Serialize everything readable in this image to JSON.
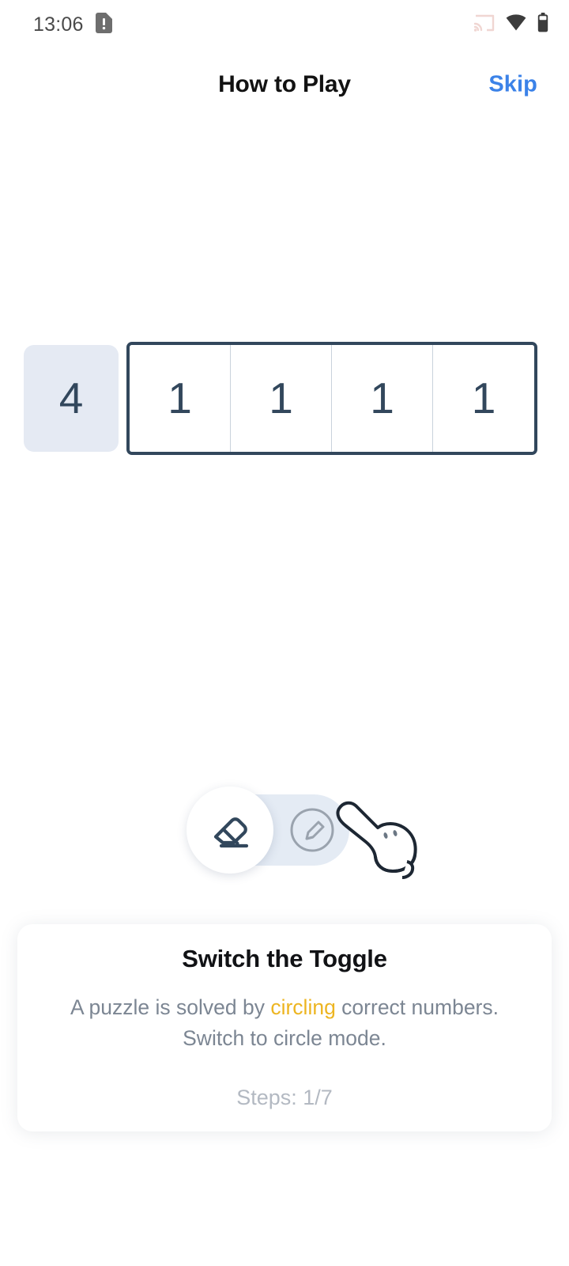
{
  "status_bar": {
    "time": "13:06",
    "sim_icon": "sim-card-alert-icon",
    "cast_icon": "cast-icon",
    "wifi_icon": "wifi-icon",
    "battery_icon": "battery-icon"
  },
  "header": {
    "title": "How to Play",
    "skip_label": "Skip"
  },
  "board": {
    "clue": "4",
    "cells": [
      "1",
      "1",
      "1",
      "1"
    ]
  },
  "toggle": {
    "left_icon": "eraser-icon",
    "right_icon": "circle-pencil-icon",
    "state": "eraser",
    "pointer_icon": "pointing-hand-icon"
  },
  "card": {
    "title": "Switch the Toggle",
    "body_part1": "A puzzle is solved by ",
    "body_highlight": "circling",
    "body_part2": " correct numbers. Switch to circle mode.",
    "steps": "Steps: 1/7"
  },
  "colors": {
    "accent_blue": "#3b82e8",
    "ink": "#32475c",
    "clue_bg": "#e5eaf3",
    "highlight": "#edb521",
    "muted": "#7c8693",
    "steps": "#b3b9c2"
  }
}
